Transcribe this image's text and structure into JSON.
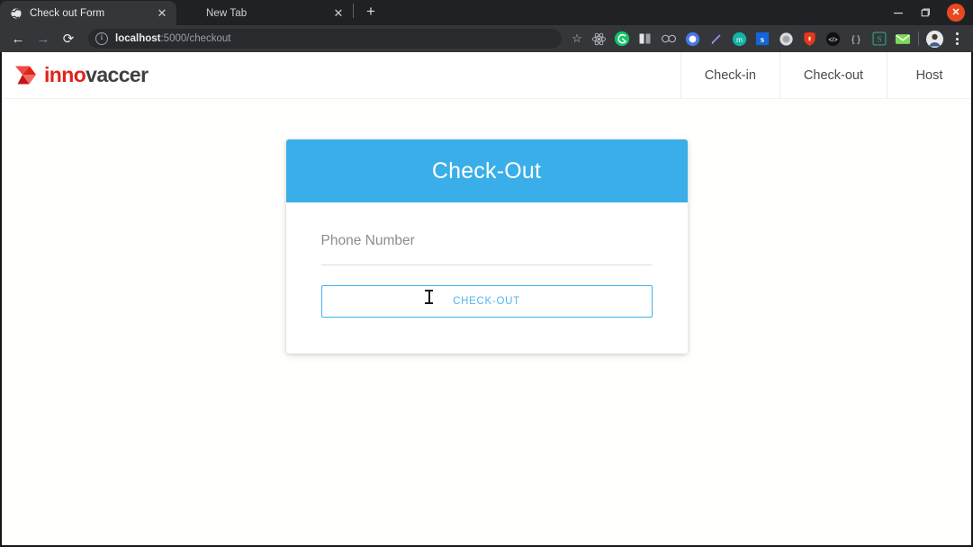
{
  "window": {
    "controls": {
      "minimize": "–",
      "maximize": "❐",
      "close": "✕"
    }
  },
  "browser": {
    "tabs": [
      {
        "title": "Check out Form",
        "favicon": "globe-icon",
        "active": true,
        "close": "✕"
      },
      {
        "title": "New Tab",
        "favicon": "none",
        "active": false,
        "close": "✕"
      }
    ],
    "new_tab_label": "+",
    "toolbar": {
      "back": "←",
      "forward": "→",
      "reload": "⟳",
      "info_glyph": "i",
      "url_host": "localhost",
      "url_path": ":5000/checkout",
      "url_full": "localhost:5000/checkout",
      "bookmark_star": "☆",
      "menu": "three-dot-menu"
    },
    "extensions": [
      {
        "name": "react-devtools-icon",
        "glyph": "⚛",
        "color": "#b7bcc2",
        "bg": "transparent"
      },
      {
        "name": "grammarly-icon",
        "glyph": "G",
        "color": "#ffffff",
        "bg": "#15c26b"
      },
      {
        "name": "columns-extension-icon",
        "glyph": "■",
        "color": "#e3e5e8",
        "bg": "transparent"
      },
      {
        "name": "infinity-extension-icon",
        "glyph": "∞",
        "color": "#b9bfc6",
        "bg": "transparent"
      },
      {
        "name": "okta-icon",
        "glyph": "O",
        "color": "#ffffff",
        "bg": "#4b75e8"
      },
      {
        "name": "pen-tool-icon",
        "glyph": "╱",
        "color": "#9b8cf0",
        "bg": "transparent"
      },
      {
        "name": "momentum-icon",
        "glyph": "m",
        "color": "#ffffff",
        "bg": "#12b5a5"
      },
      {
        "name": "s-blue-extension-icon",
        "glyph": "s",
        "color": "#ffffff",
        "bg": "#1565d8"
      },
      {
        "name": "circle-gray-extension-icon",
        "glyph": "◉",
        "color": "#d8dadd",
        "bg": "transparent"
      },
      {
        "name": "lastpass-icon",
        "glyph": "▮",
        "color": "#ffffff",
        "bg": "#e8371a"
      },
      {
        "name": "code-extension-icon",
        "glyph": "</>",
        "color": "#ffffff",
        "bg": "#111111"
      },
      {
        "name": "json-viewer-icon",
        "glyph": "{ }",
        "color": "#d4d7da",
        "bg": "transparent"
      },
      {
        "name": "s-green-extension-icon",
        "glyph": "S",
        "color": "#2aa37f",
        "bg": "transparent"
      },
      {
        "name": "mail-extension-icon",
        "glyph": "✉",
        "color": "#ffffff",
        "bg": "#7ed957"
      }
    ],
    "profile": {
      "name": "profile-avatar",
      "glyph": "👤"
    }
  },
  "page": {
    "header": {
      "logo": {
        "name": "innovaccer-logo",
        "text_red": "inno",
        "text_dark": "vaccer"
      },
      "nav": [
        {
          "label": "Check-in"
        },
        {
          "label": "Check-out"
        },
        {
          "label": "Host"
        }
      ]
    },
    "card": {
      "title": "Check-Out",
      "phone_field": {
        "placeholder": "Phone Number",
        "value": ""
      },
      "submit_label": "CHECK-OUT"
    }
  },
  "colors": {
    "card_header_blue": "#3aaee8",
    "button_border_blue": "#41b2f2",
    "button_text_blue": "#53b6ef",
    "brand_red": "#e2231a",
    "brand_dark": "#404040",
    "page_bg": "#fffffe"
  }
}
